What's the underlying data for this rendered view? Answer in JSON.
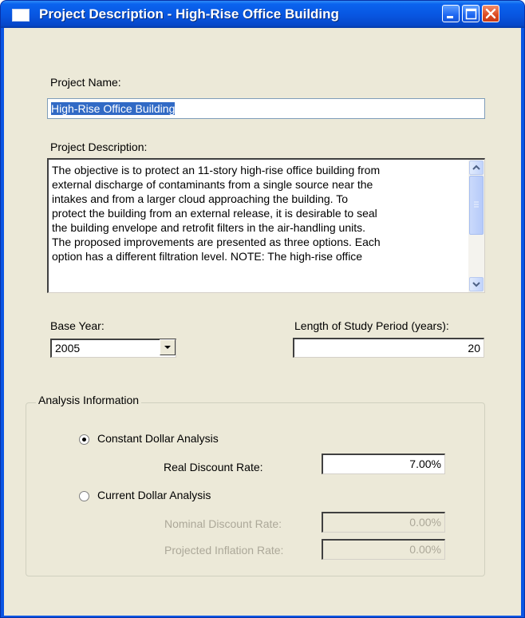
{
  "window": {
    "title": "Project Description - High-Rise Office Building",
    "buttons": {
      "minimize": "minimize-icon",
      "maximize": "maximize-icon",
      "close": "close-icon"
    }
  },
  "project_name": {
    "label": "Project Name:",
    "value": "High-Rise Office Building"
  },
  "project_description": {
    "label": "Project Description:",
    "text": "The objective is to protect an 11-story high-rise office building from\nexternal discharge of contaminants from a single source near the\nintakes and from a larger cloud approaching the building.  To\nprotect the building from an external release, it is desirable to seal\nthe building envelope and retrofit filters in the air-handling units.\nThe proposed improvements are presented as three options.  Each\noption has a different filtration level.  NOTE: The high-rise office"
  },
  "base_year": {
    "label": "Base Year:",
    "selected": "2005"
  },
  "study_period": {
    "label": "Length of Study Period (years):",
    "value": "20"
  },
  "analysis": {
    "group_title": "Analysis Information",
    "constant": {
      "label": "Constant Dollar Analysis",
      "selected": true,
      "real_discount_rate_label": "Real Discount Rate:",
      "real_discount_rate": "7.00%"
    },
    "current": {
      "label": "Current Dollar Analysis",
      "selected": false,
      "nominal_discount_rate_label": "Nominal Discount Rate:",
      "nominal_discount_rate": "0.00%",
      "projected_inflation_rate_label": "Projected Inflation Rate:",
      "projected_inflation_rate": "0.00%"
    }
  },
  "colors": {
    "title_bar": "#0855e0",
    "dialog_bg": "#ece9d8",
    "selection": "#316ac5",
    "disabled_text": "#aca899"
  }
}
